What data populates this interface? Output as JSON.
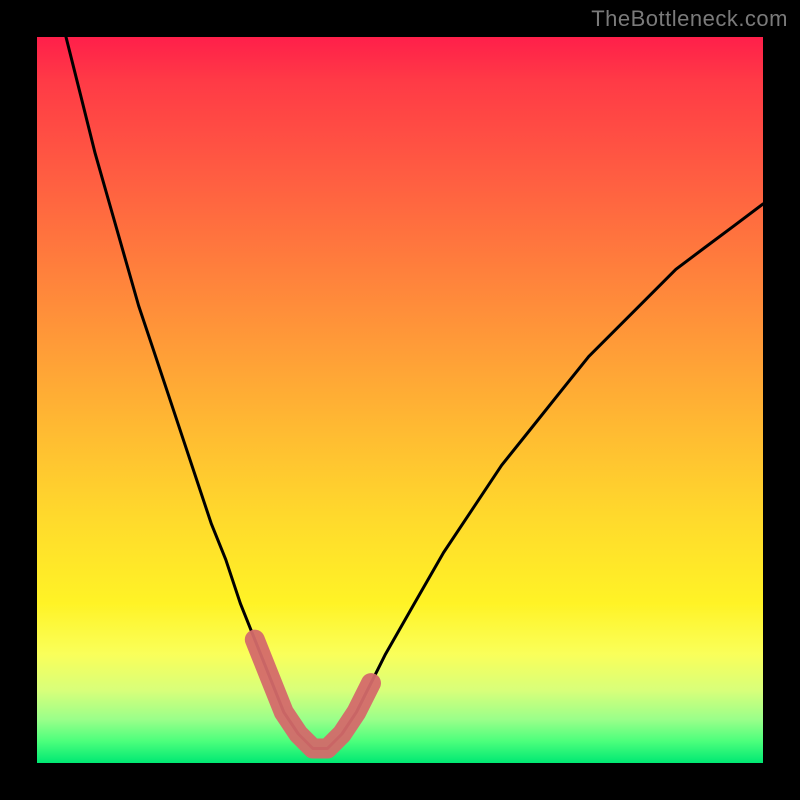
{
  "watermark": "TheBottleneck.com",
  "chart_data": {
    "type": "line",
    "title": "",
    "xlabel": "",
    "ylabel": "",
    "xlim": [
      0,
      100
    ],
    "ylim": [
      0,
      100
    ],
    "series": [
      {
        "name": "main-curve",
        "x": [
          4,
          6,
          8,
          10,
          12,
          14,
          16,
          18,
          20,
          22,
          24,
          26,
          28,
          30,
          32,
          34,
          36,
          38,
          40,
          42,
          44,
          46,
          48,
          52,
          56,
          60,
          64,
          68,
          72,
          76,
          80,
          84,
          88,
          92,
          96,
          100
        ],
        "y": [
          100,
          92,
          84,
          77,
          70,
          63,
          57,
          51,
          45,
          39,
          33,
          28,
          22,
          17,
          12,
          7,
          4,
          2,
          2,
          4,
          7,
          11,
          15,
          22,
          29,
          35,
          41,
          46,
          51,
          56,
          60,
          64,
          68,
          71,
          74,
          77
        ]
      },
      {
        "name": "highlight-segment",
        "x": [
          30,
          32,
          34,
          36,
          38,
          40,
          42,
          44,
          46
        ],
        "y": [
          17,
          12,
          7,
          4,
          2,
          2,
          4,
          7,
          11
        ]
      }
    ],
    "colors": {
      "curve": "#000000",
      "highlight": "#d46a6a",
      "gradient_top": "#ff1f4a",
      "gradient_bottom": "#00e873"
    }
  }
}
